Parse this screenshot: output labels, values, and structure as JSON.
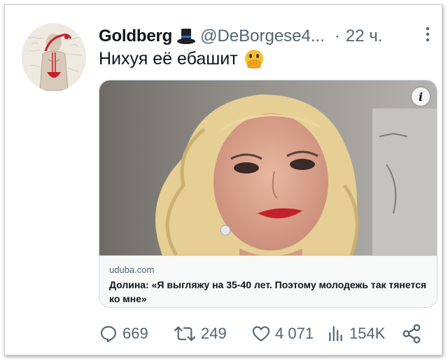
{
  "tweet": {
    "author_name": "Goldberg",
    "author_handle": "@DeBorgese4...",
    "time": "22 ч.",
    "separator": "·",
    "text": "Нихуя её ебашит"
  },
  "card": {
    "domain": "uduba.com",
    "title": "Долина: «Я выгляжу на 35-40 лет. Поэтому молодежь так тянется ко мне»",
    "info_label": "i"
  },
  "actions": {
    "replies": "669",
    "retweets": "249",
    "likes": "4 071",
    "views": "154K"
  },
  "colors": {
    "text_primary": "#0f1419",
    "text_secondary": "#536471",
    "border": "#cfd9de"
  }
}
